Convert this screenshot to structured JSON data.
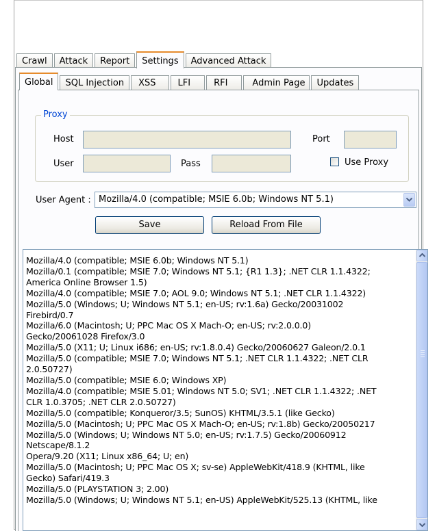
{
  "main_tabs": [
    "Crawl",
    "Attack",
    "Report",
    "Settings",
    "Advanced Attack"
  ],
  "sub_tabs": [
    "Global",
    "SQL Injection",
    "XSS",
    "LFI",
    "RFI",
    "Admin Page",
    "Updates"
  ],
  "proxy": {
    "group_label": "Proxy",
    "host_label": "Host",
    "host_value": "",
    "port_label": "Port",
    "port_value": "",
    "user_label": "User",
    "user_value": "",
    "pass_label": "Pass",
    "pass_value": "",
    "use_proxy_label": "Use Proxy",
    "use_proxy_checked": false
  },
  "user_agent": {
    "label": "User Agent :",
    "selected": "Mozilla/4.0 (compatible; MSIE 6.0b; Windows NT 5.1)"
  },
  "buttons": {
    "save": "Save",
    "reload": "Reload From File"
  },
  "agent_list": [
    "Mozilla/4.0 (compatible; MSIE 6.0b; Windows NT 5.1)",
    "Mozilla/0.1 (compatible; MSIE 7.0; Windows NT 5.1; {R1 1.3}; .NET CLR 1.1.4322;",
    "America Online Browser 1.5)",
    "Mozilla/4.0 (compatible; MSIE 7.0; AOL 9.0; Windows NT 5.1; .NET CLR 1.1.4322)",
    "Mozilla/5.0 (Windows; U; Windows NT 5.1; en-US; rv:1.6a) Gecko/20031002",
    "Firebird/0.7",
    "Mozilla/6.0 (Macintosh; U; PPC Mac OS X Mach-O; en-US; rv:2.0.0.0)",
    "Gecko/20061028 Firefox/3.0",
    "Mozilla/5.0 (X11; U; Linux i686; en-US; rv:1.8.0.4) Gecko/20060627 Galeon/2.0.1",
    "Mozilla/5.0 (compatible; MSIE 7.0; Windows NT 5.1; .NET CLR 1.1.4322; .NET CLR",
    "2.0.50727)",
    "Mozilla/5.0 (compatible; MSIE 6.0; Windows XP)",
    "Mozilla/4.0 (compatible; MSIE 5.01; Windows NT 5.0; SV1; .NET CLR 1.1.4322; .NET",
    "CLR 1.0.3705; .NET CLR 2.0.50727)",
    "Mozilla/5.0 (compatible; Konqueror/3.5; SunOS) KHTML/3.5.1 (like Gecko)",
    "Mozilla/5.0 (Macintosh; U; PPC Mac OS X Mach-O; en-US; rv:1.8b) Gecko/20050217",
    "Mozilla/5.0 (Windows; U; Windows NT 5.0; en-US; rv:1.7.5) Gecko/20060912",
    "Netscape/8.1.2",
    "Opera/9.20 (X11; Linux x86_64; U; en)",
    "Mozilla/5.0 (Macintosh; U; PPC Mac OS X; sv-se) AppleWebKit/418.9 (KHTML, like",
    "Gecko) Safari/419.3",
    "Mozilla/5.0 (PLAYSTATION 3; 2.00)",
    "Mozilla/5.0 (Windows; U; Windows NT 5.1; en-US) AppleWebKit/525.13 (KHTML, like"
  ],
  "icons": {
    "dropdown": "chevron-down-icon",
    "scroll_up": "arrow-up-icon",
    "scroll_down": "arrow-down-icon"
  },
  "colors": {
    "active_tab_accent": "#e68b2c",
    "group_label": "#0046d5",
    "scroll_blue": "#b7cbf4"
  }
}
